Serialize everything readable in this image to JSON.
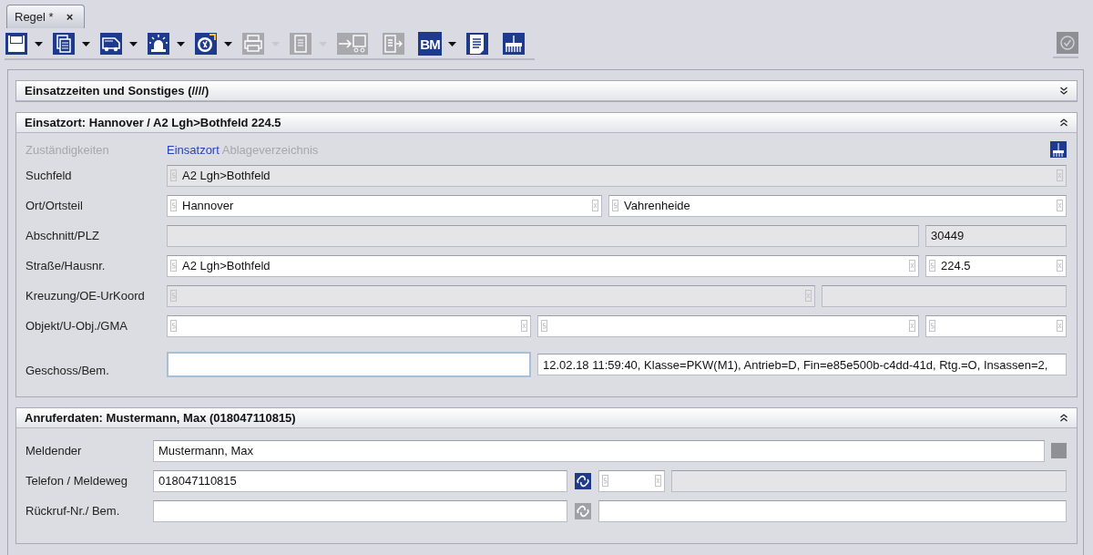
{
  "tab": {
    "label": "Regel *",
    "close": "×",
    "selected": true
  },
  "toolbar": {
    "items": [
      {
        "disabled": false,
        "menu": true
      },
      {
        "disabled": false,
        "menu": true
      },
      {
        "disabled": false,
        "menu": true
      },
      {
        "disabled": false,
        "menu": true
      },
      {
        "disabled": false,
        "menu": true
      },
      {
        "disabled": true,
        "menu": true
      },
      {
        "disabled": true,
        "menu": true
      },
      {
        "disabled": true,
        "menu": false
      },
      {
        "disabled": true,
        "menu": false
      },
      {
        "label": "BM",
        "disabled": false,
        "menu": true
      },
      {
        "disabled": false,
        "menu": false
      },
      {
        "disabled": false,
        "menu": false
      }
    ],
    "confirm": {
      "disabled": true
    }
  },
  "sections": [
    {
      "title": "Einsatzzeiten und Sonstiges (////)",
      "expanded": false
    },
    {
      "title": "Einsatzort: Hannover / A2 Lgh>Bothfeld 224.5",
      "expanded": true,
      "corner_button": true,
      "links": [
        {
          "label": "Zuständigkeiten",
          "disabled": true,
          "selected": false
        },
        {
          "label": "Einsatzort",
          "disabled": false,
          "selected": true
        },
        {
          "label": "Ablageverzeichnis",
          "disabled": true,
          "selected": false
        }
      ],
      "rows": [
        {
          "label": "Suchfeld",
          "kind": "full",
          "items": [
            {
              "kind": "field",
              "value": "A2 Lgh>Bothfeld",
              "disabled": true,
              "search": true,
              "clear": true,
              "focused": false
            }
          ]
        },
        {
          "label": "Ort/Ortsteil",
          "kind": "pair",
          "items": [
            {
              "kind": "field",
              "value": "Hannover",
              "disabled": false,
              "search": true,
              "clear": true,
              "focused": false
            },
            {
              "kind": "field",
              "value": "Vahrenheide",
              "disabled": false,
              "search": true,
              "clear": true,
              "focused": false
            }
          ]
        },
        {
          "label": "Abschnitt/PLZ",
          "kind": "main-side",
          "items": [
            {
              "kind": "field",
              "disabled": true,
              "search": false,
              "clear": false,
              "focused": false
            },
            {
              "kind": "field",
              "value": "30449",
              "disabled": true,
              "search": false,
              "clear": false,
              "focused": false
            }
          ]
        },
        {
          "label": "Straße/Hausnr.",
          "kind": "main-side",
          "items": [
            {
              "kind": "field",
              "value": "A2 Lgh>Bothfeld",
              "disabled": false,
              "search": true,
              "clear": true,
              "focused": false
            },
            {
              "kind": "field",
              "value": "224.5",
              "disabled": false,
              "search": true,
              "clear": true,
              "focused": false
            }
          ]
        },
        {
          "label": "Kreuzung/OE-UrKoord",
          "kind": "cross",
          "items": [
            {
              "kind": "field",
              "disabled": true,
              "search": true,
              "clear": true,
              "focused": false
            },
            {
              "kind": "field",
              "disabled": true,
              "search": false,
              "clear": false,
              "focused": false
            }
          ]
        },
        {
          "label": "Objekt/U-Obj./GMA",
          "kind": "triple",
          "items": [
            {
              "kind": "field",
              "disabled": false,
              "search": true,
              "clear": true,
              "focused": false
            },
            {
              "kind": "field",
              "disabled": false,
              "search": true,
              "clear": true,
              "focused": false
            },
            {
              "kind": "field",
              "disabled": false,
              "search": true,
              "clear": true,
              "focused": false
            }
          ]
        },
        {
          "label": "Geschoss/Bem.",
          "kind": "note",
          "items": [
            {
              "kind": "field",
              "disabled": false,
              "search": false,
              "clear": false,
              "focused": true
            },
            {
              "kind": "field",
              "value": "12.02.18 11:59:40, Klasse=PKW(M1), Antrieb=D, Fin=e85e500b-c4dd-41d, Rtg.=O, Insassen=2,",
              "disabled": false,
              "search": false,
              "clear": false,
              "focused": false
            }
          ]
        }
      ]
    },
    {
      "title": "Anruferdaten: Mustermann, Max (018047110815)",
      "expanded": true,
      "rows": [
        {
          "label": "Meldender",
          "kind": "caller",
          "items": [
            {
              "kind": "field",
              "value": "Mustermann, Max",
              "disabled": false,
              "search": false,
              "clear": false,
              "focused": false
            },
            {
              "kind": "square",
              "disabled": true
            }
          ]
        },
        {
          "label": "Telefon / Meldeweg",
          "kind": "phone",
          "items": [
            {
              "kind": "field",
              "value": "018047110815",
              "disabled": false,
              "search": false,
              "clear": false,
              "focused": false
            },
            {
              "kind": "link",
              "disabled": false
            },
            {
              "kind": "field",
              "disabled": false,
              "search": true,
              "clear": true,
              "focused": false
            },
            {
              "kind": "field",
              "disabled": true,
              "search": false,
              "clear": false,
              "focused": false
            }
          ]
        },
        {
          "label": "Rückruf-Nr./ Bem.",
          "kind": "callback",
          "items": [
            {
              "kind": "field",
              "disabled": false,
              "search": false,
              "clear": false,
              "focused": false
            },
            {
              "kind": "link",
              "disabled": true
            },
            {
              "kind": "field",
              "disabled": false,
              "search": false,
              "clear": false,
              "focused": false
            }
          ]
        }
      ]
    }
  ]
}
